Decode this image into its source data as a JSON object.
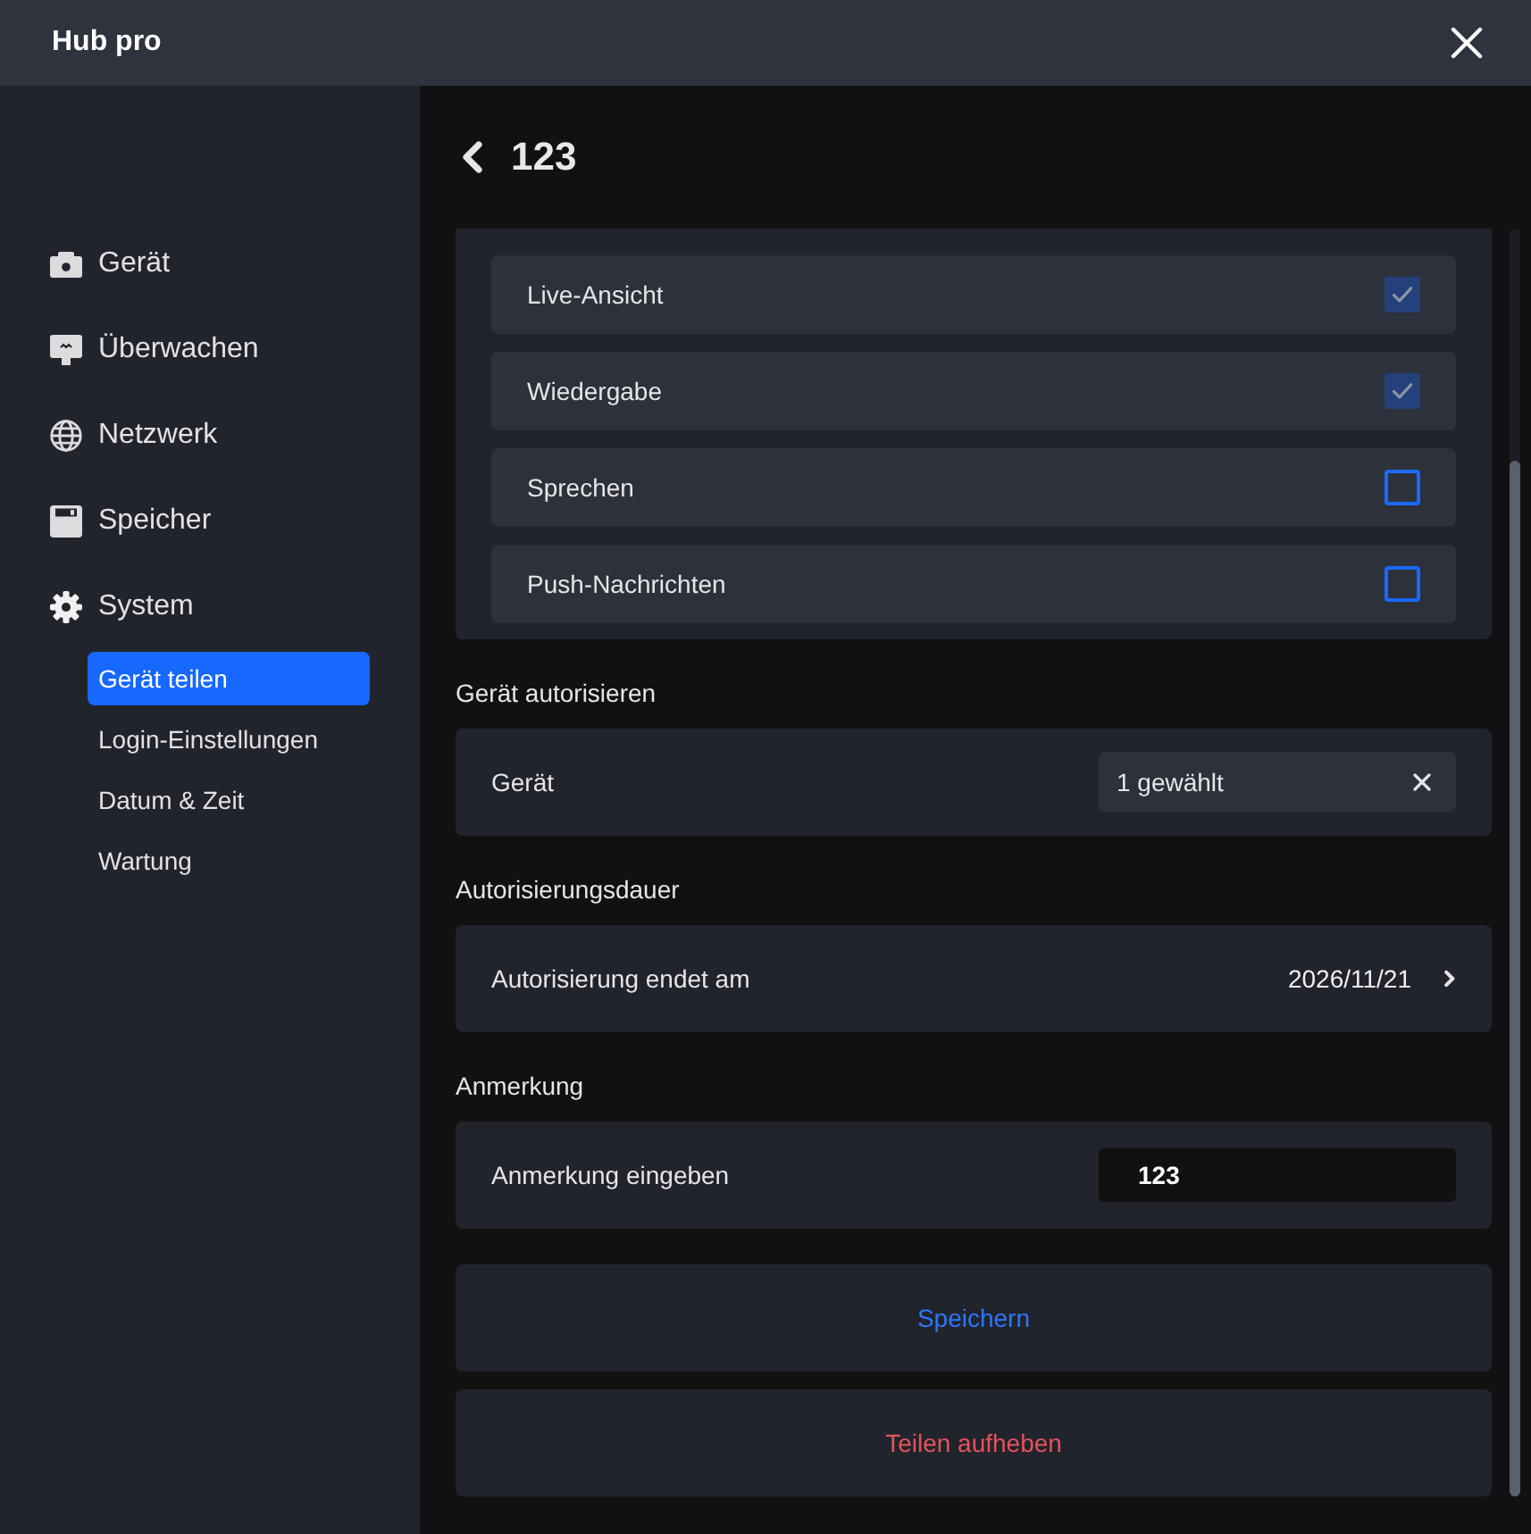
{
  "window": {
    "title": "Hub pro"
  },
  "sidebar": {
    "items": [
      {
        "label": "Gerät",
        "selected": false
      },
      {
        "label": "Überwachen",
        "selected": false
      },
      {
        "label": "Netzwerk",
        "selected": false
      },
      {
        "label": "Speicher",
        "selected": false
      },
      {
        "label": "System",
        "selected": false,
        "children": [
          {
            "label": "Gerät teilen",
            "selected": true
          },
          {
            "label": "Login-Einstellungen",
            "selected": false
          },
          {
            "label": "Datum & Zeit",
            "selected": false
          },
          {
            "label": "Wartung",
            "selected": false
          }
        ]
      }
    ]
  },
  "page": {
    "title": "123"
  },
  "permissions": [
    {
      "label": "Live-Ansicht",
      "checked": true
    },
    {
      "label": "Wiedergabe",
      "checked": true
    },
    {
      "label": "Sprechen",
      "checked": false
    },
    {
      "label": "Push-Nachrichten",
      "checked": false
    }
  ],
  "sections": [
    {
      "kind": "select",
      "heading": "Gerät autorisieren",
      "label": "Gerät",
      "value": "1 gewählt"
    },
    {
      "kind": "date",
      "heading": "Autorisierungsdauer",
      "label": "Autorisierung endet am",
      "value": "2026/11/21"
    },
    {
      "kind": "input",
      "heading": "Anmerkung",
      "label": "Anmerkung eingeben",
      "value": "123"
    }
  ],
  "buttons": [
    {
      "label": "Speichern",
      "kind": "primary"
    },
    {
      "label": "Teilen aufheben",
      "kind": "danger"
    }
  ]
}
